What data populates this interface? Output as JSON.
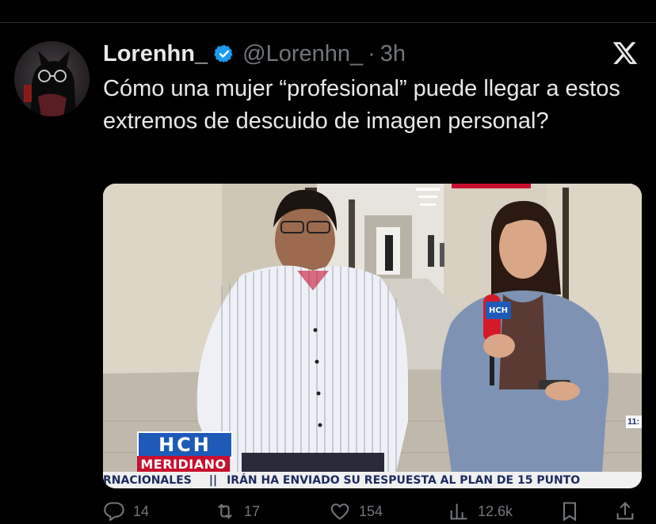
{
  "tweet": {
    "author_name": "Lorenhn_",
    "handle": "@Lorenhn_",
    "separator": "·",
    "time": "3h",
    "text": "Cómo una mujer “profesional” puede llegar a estos extremos de descuido de imagen personal?",
    "verified": true,
    "icons": {
      "avatar": "avatar-cat-icon",
      "verified": "verified-badge-icon",
      "logo": "x-logo-icon"
    }
  },
  "media": {
    "kind": "video-frame",
    "channel_logo": "HCH",
    "program_label": "MERIDIANO",
    "ticker_left": "RNACIONALES",
    "ticker_separator": "||",
    "ticker_headline": "IRÁN HA ENVIADO SU RESPUESTA AL PLAN DE 15 PUNTO",
    "clock_fragment": "11:",
    "mic_flag": "HCH"
  },
  "actions": [
    {
      "name": "reply",
      "icon": "reply-icon",
      "count": "14"
    },
    {
      "name": "retweet",
      "icon": "retweet-icon",
      "count": "17"
    },
    {
      "name": "like",
      "icon": "heart-icon",
      "count": "154"
    },
    {
      "name": "views",
      "icon": "views-icon",
      "count": "12.6k"
    },
    {
      "name": "bookmark",
      "icon": "bookmark-icon",
      "count": ""
    },
    {
      "name": "share",
      "icon": "share-icon",
      "count": ""
    }
  ],
  "colors": {
    "background": "#000000",
    "text_primary": "#e7e9ea",
    "text_secondary": "#71767b",
    "verified_blue": "#1d9bf0",
    "hch_blue": "#1e5bb8",
    "hch_red": "#c8102e"
  }
}
